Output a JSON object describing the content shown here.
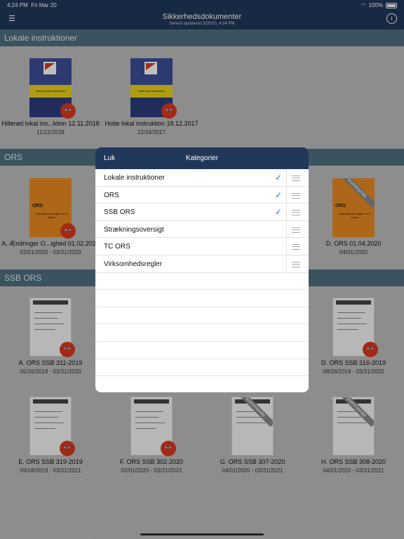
{
  "status": {
    "time": "4:24 PM",
    "day": "Fri Mar 20",
    "battery": "100%",
    "wifi_icon": "wifi-icon"
  },
  "nav": {
    "title": "Sikkerhedsdokumenter",
    "subtitle": "Senest opdateret:3/20/20, 4:24 PM",
    "menu_icon": "list-icon",
    "info_icon": "info-icon"
  },
  "sections": {
    "lokale": {
      "title": "Lokale instruktioner",
      "items": [
        {
          "label": "Hillerød lokal ins...ktion 12.11.2018",
          "date": "11/12/2018",
          "thumb_text": "Hillerød lokal instruktion"
        },
        {
          "label": "Holte lokal instruktion 18.12.2017",
          "date": "12/18/2017",
          "thumb_text": "Holte lokal instruktion"
        }
      ]
    },
    "ors": {
      "title": "ORS",
      "items": [
        {
          "label": "A. Ændringer O...ighed 01.02.2020",
          "date": "02/01/2020 - 03/31/2020",
          "thumb_title": "ORS",
          "thumb_sub": "Operationale Regler for S-banen"
        },
        {
          "label": "D. ORS 01.04.2020",
          "date": "04/01/2020",
          "thumb_title": "ORS",
          "thumb_sub": "Operationale Regler for S-banen",
          "badge": "Kommende"
        }
      ]
    },
    "ssb": {
      "title": "SSB ORS",
      "items": [
        {
          "label": "A. ORS SSB 311-2019",
          "date": "05/26/2019 - 03/31/2020"
        },
        {
          "label": "D. ORS SSB 316-2019",
          "date": "08/26/2019 - 03/31/2020"
        },
        {
          "label": "E. ORS SSB 319-2019",
          "date": "09/18/2019 - 03/31/2021"
        },
        {
          "label": "F. ORS SSB 302-2020",
          "date": "02/01/2020 - 03/31/2021"
        },
        {
          "label": "G. ORS SSB 307-2020",
          "date": "04/01/2020 - 03/31/2021",
          "badge": "Kommende"
        },
        {
          "label": "H. ORS SSB 308-2020",
          "date": "04/01/2020 - 03/31/2021",
          "badge": "Kommende"
        }
      ]
    }
  },
  "modal": {
    "close_label": "Luk",
    "title": "Kategorier",
    "rows": [
      {
        "label": "Lokale instruktioner",
        "checked": true
      },
      {
        "label": "ORS",
        "checked": true
      },
      {
        "label": "SSB ORS",
        "checked": true
      },
      {
        "label": "Strækningsoversigt",
        "checked": false
      },
      {
        "label": "TC ORS",
        "checked": false
      },
      {
        "label": "Virksomhedsregler",
        "checked": false
      }
    ],
    "check_glyph": "✓"
  },
  "colors": {
    "nav": "#21375a",
    "section": "#4e6f7e",
    "accent": "#1e7bd8",
    "badge_red": "#d8391f"
  }
}
